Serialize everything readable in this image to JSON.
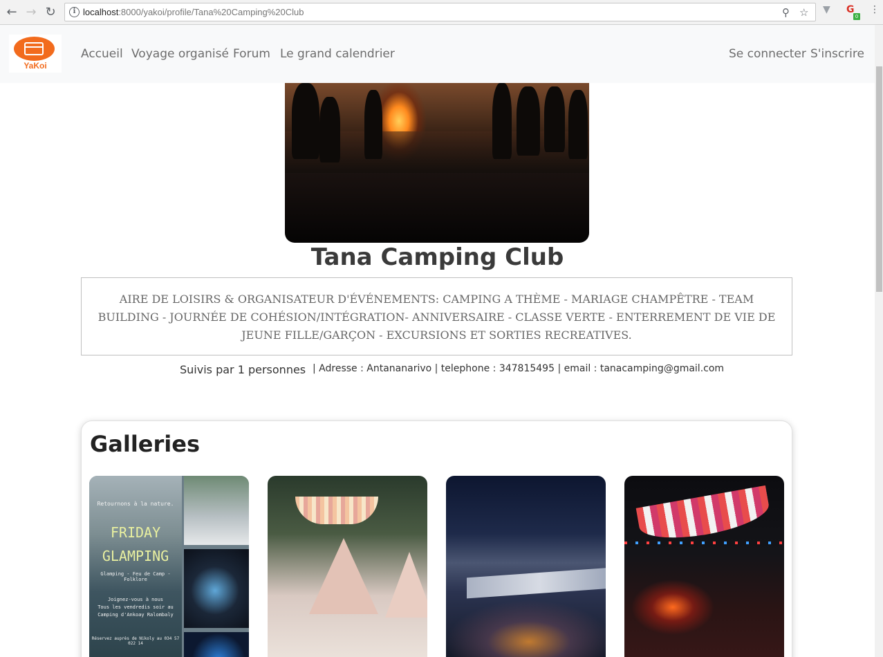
{
  "browser": {
    "url_host": "localhost",
    "url_path": ":8000/yakoi/profile/Tana%20Camping%20Club",
    "extension_badge": "0"
  },
  "navbar": {
    "logo_text": "YaKoi",
    "links": [
      "Accueil",
      "Voyage organisé",
      "Forum",
      "Le grand calendrier"
    ],
    "login": "Se connecter",
    "signup": "S'inscrire"
  },
  "profile": {
    "name": "Tana Camping Club",
    "description": "AIRE DE LOISIRS & ORGANISATEUR D'ÉVÉNEMENTS: CAMPING A THÈME - MARIAGE CHAMPÊTRE - TEAM BUILDING - JOURNÉE DE COHÉSION/INTÉGRATION- ANNIVERSAIRE - CLASSE VERTE - ENTERREMENT DE VIE DE JEUNE FILLE/GARÇON - EXCURSIONS ET SORTIES RECREATIVES.",
    "followers": "Suivis par 1 personnes",
    "contact": "| Adresse : Antananarivo | telephone : 347815495 | email : tanacamping@gmail.com"
  },
  "gallery": {
    "title": "Galleries",
    "flyer": {
      "line1": "Retournons à la nature.",
      "line2": "FRIDAY",
      "line3": "GLAMPING",
      "line4": "Glamping - Feu de Camp - Folklore",
      "line5": "Joignez-vous à nous",
      "line6": "Tous les vendredis soir au",
      "line7": "Camping d'Ankoay Ralombaly",
      "line8": "Réservez auprès de Nikoly au 034 57 022 14"
    }
  },
  "colors": {
    "brand": "#f26b1d",
    "nav_bg": "#f8f9fa"
  }
}
